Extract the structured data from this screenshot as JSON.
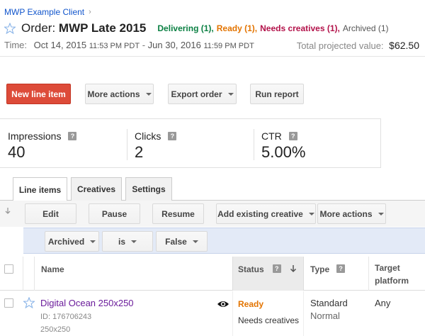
{
  "breadcrumb": {
    "client": "MWP Example Client",
    "separator": "›"
  },
  "order": {
    "prefix": "Order:",
    "name": "MWP Late 2015",
    "statuses": {
      "delivering": "Delivering (1),",
      "ready": "Ready (1),",
      "needs_creatives": "Needs creatives (1),",
      "archived": "Archived (1)"
    },
    "time_label": "Time:",
    "start_date": "Oct 14, 2015",
    "start_time": "11:53 PM PDT",
    "dash": "-",
    "end_date": "Jun 30, 2016",
    "end_time": "11:59 PM PDT",
    "projected_label": "Total projected value:",
    "projected_value": "$62.50"
  },
  "actions": {
    "new_line_item": "New line item",
    "more_actions": "More actions",
    "export_order": "Export order",
    "run_report": "Run report"
  },
  "stats": {
    "impressions_label": "Impressions",
    "impressions_value": "40",
    "clicks_label": "Clicks",
    "clicks_value": "2",
    "ctr_label": "CTR",
    "ctr_value": "5.00%"
  },
  "tabs": [
    "Line items",
    "Creatives",
    "Settings"
  ],
  "toolbar": {
    "edit": "Edit",
    "pause": "Pause",
    "resume": "Resume",
    "add_existing_creative": "Add existing creative",
    "more_actions": "More actions"
  },
  "filter": {
    "field": "Archived",
    "operator": "is",
    "value": "False"
  },
  "table": {
    "headers": {
      "name": "Name",
      "status": "Status",
      "type": "Type",
      "target_line1": "Target",
      "target_line2": "platform"
    },
    "rows": [
      {
        "name": "Digital Ocean 250x250",
        "id": "ID: 176706243",
        "size": "250x250",
        "status_primary": "Ready",
        "status_secondary": "Needs creatives",
        "type_primary": "Standard",
        "type_secondary": "Normal",
        "target_platform": "Any"
      }
    ]
  },
  "help_glyph": "?",
  "colors": {
    "primary_button": "#dd4b39",
    "link": "#1155cc",
    "delivering": "#0b8043",
    "ready": "#e37400",
    "needs_creatives": "#b3124a",
    "line_item_link": "#6a1b9a"
  }
}
